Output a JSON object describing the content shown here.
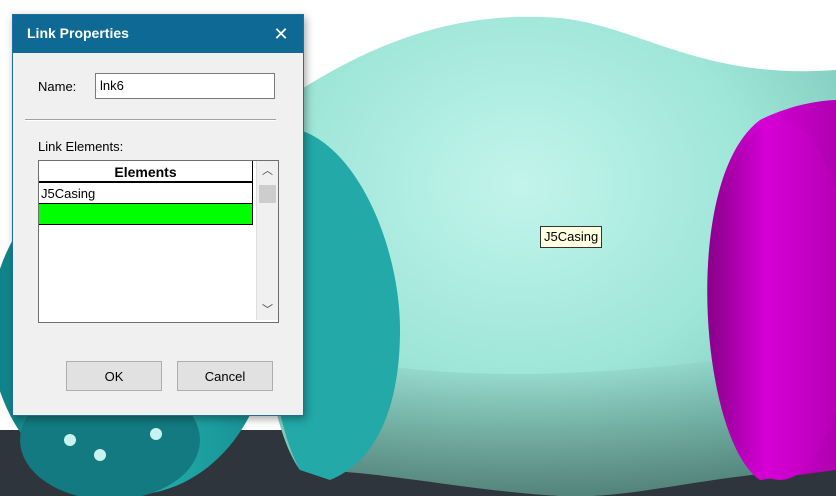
{
  "dialog": {
    "title": "Link Properties",
    "close_glyph": "✕",
    "name_label": "Name:",
    "name_value": "lnk6",
    "elements_label": "Link Elements:",
    "grid": {
      "header": "Elements",
      "rows": [
        "J5Casing",
        ""
      ],
      "selected_row_color": "#00ff00"
    },
    "ok_label": "OK",
    "cancel_label": "Cancel"
  },
  "viewport": {
    "tooltip": "J5Casing",
    "colors": {
      "casing": "#9ee6d8",
      "teal_joint": "#1aa6a6",
      "magenta_joint": "#cc00cc",
      "background": "#2f353c"
    }
  },
  "icons": {
    "scroll_up": "chevron-up-icon",
    "scroll_down": "chevron-down-icon",
    "close": "close-icon"
  }
}
